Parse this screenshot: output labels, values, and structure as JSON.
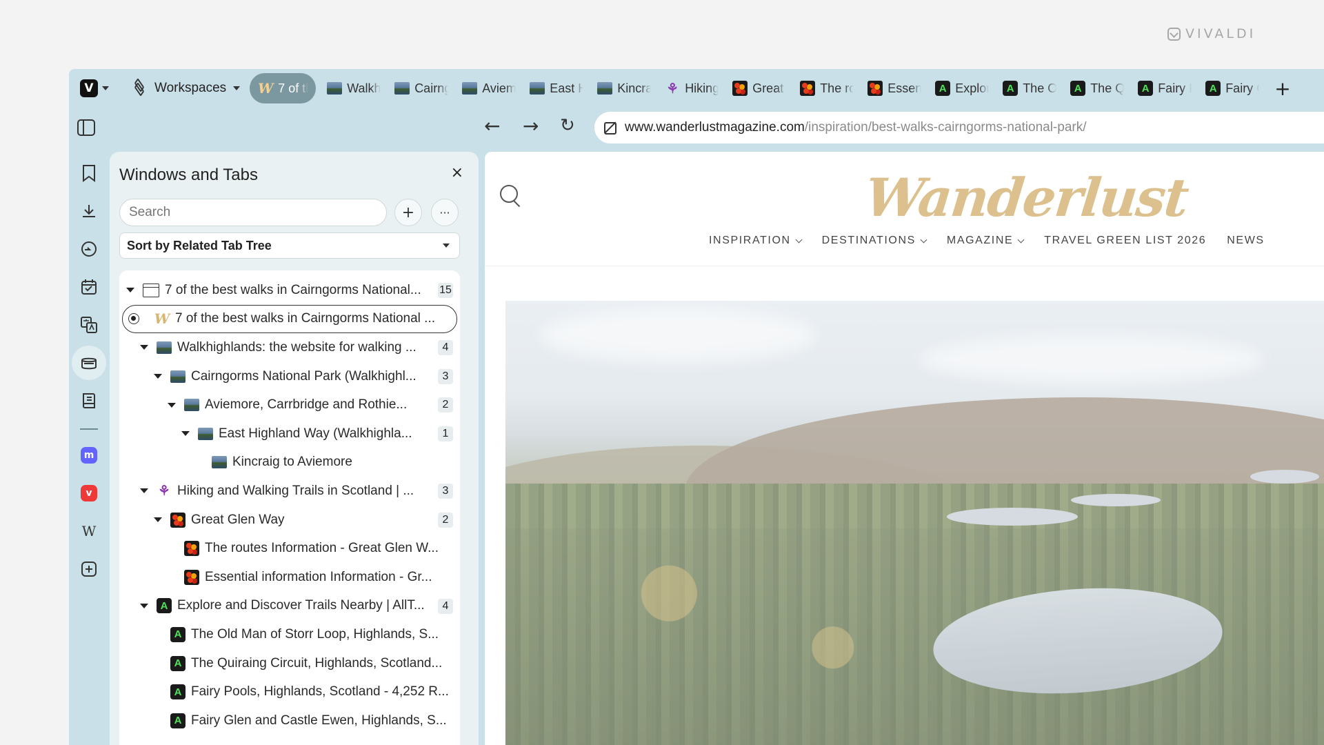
{
  "brand_watermark": "VIVALDI",
  "tabbar": {
    "workspaces_label": "Workspaces",
    "stack_tab": "7 of th",
    "tabs": [
      {
        "title": "Walkh",
        "favicon": "walkhighlands-icon"
      },
      {
        "title": "Cairng",
        "favicon": "walkhighlands-icon"
      },
      {
        "title": "Aviem",
        "favicon": "walkhighlands-icon"
      },
      {
        "title": "East H",
        "favicon": "walkhighlands-icon"
      },
      {
        "title": "Kincra",
        "favicon": "walkhighlands-icon"
      },
      {
        "title": "Hiking",
        "favicon": "thistle-icon"
      },
      {
        "title": "Great",
        "favicon": "great-glen-icon"
      },
      {
        "title": "The ro",
        "favicon": "great-glen-icon"
      },
      {
        "title": "Essent",
        "favicon": "great-glen-icon"
      },
      {
        "title": "Explor",
        "favicon": "alltrails-icon"
      },
      {
        "title": "The O",
        "favicon": "alltrails-icon"
      },
      {
        "title": "The Q",
        "favicon": "alltrails-icon"
      },
      {
        "title": "Fairy P",
        "favicon": "alltrails-icon"
      },
      {
        "title": "Fairy G",
        "favicon": "alltrails-icon"
      }
    ],
    "new_tab": "+"
  },
  "address": {
    "domain": "www.wanderlustmagazine.com",
    "path": "/inspiration/best-walks-cairngorms-national-park/"
  },
  "panel": {
    "title": "Windows and Tabs",
    "close": "×",
    "search_placeholder": "Search",
    "add": "+",
    "more": "···",
    "sort_label": "Sort by Related Tab Tree",
    "tree": [
      {
        "label": "7 of the best walks in Cairngorms National...",
        "count": "15",
        "kind": "window"
      },
      {
        "label": "7 of the best walks in Cairngorms National ...",
        "count": "",
        "kind": "current"
      },
      {
        "label": "Walkhighlands: the website for walking ...",
        "count": "4",
        "depth": 1,
        "favicon": "walkhighlands-icon"
      },
      {
        "label": "Cairngorms National Park (Walkhighl...",
        "count": "3",
        "depth": 2,
        "favicon": "walkhighlands-icon"
      },
      {
        "label": "Aviemore, Carrbridge and Rothie...",
        "count": "2",
        "depth": 3,
        "favicon": "walkhighlands-icon"
      },
      {
        "label": "East Highland Way (Walkhighla...",
        "count": "1",
        "depth": 4,
        "favicon": "walkhighlands-icon"
      },
      {
        "label": "Kincraig to Aviemore",
        "count": "",
        "depth": 5,
        "favicon": "walkhighlands-icon"
      },
      {
        "label": "Hiking and Walking Trails in Scotland | ...",
        "count": "3",
        "depth": 1,
        "favicon": "thistle-icon"
      },
      {
        "label": "Great Glen Way",
        "count": "2",
        "depth": 2,
        "favicon": "great-glen-icon"
      },
      {
        "label": "The routes Information - Great Glen W...",
        "count": "",
        "depth": 3,
        "favicon": "great-glen-icon"
      },
      {
        "label": "Essential information Information - Gr...",
        "count": "",
        "depth": 3,
        "favicon": "great-glen-icon"
      },
      {
        "label": "Explore and Discover Trails Nearby | AllT...",
        "count": "4",
        "depth": 1,
        "favicon": "alltrails-icon"
      },
      {
        "label": "The Old Man of Storr Loop, Highlands, S...",
        "count": "",
        "depth": 2,
        "favicon": "alltrails-icon"
      },
      {
        "label": "The Quiraing Circuit, Highlands, Scotland...",
        "count": "",
        "depth": 2,
        "favicon": "alltrails-icon"
      },
      {
        "label": "Fairy Pools, Highlands, Scotland - 4,252 R...",
        "count": "",
        "depth": 2,
        "favicon": "alltrails-icon"
      },
      {
        "label": "Fairy Glen and Castle Ewen, Highlands, S...",
        "count": "",
        "depth": 2,
        "favicon": "alltrails-icon"
      }
    ]
  },
  "website": {
    "logo": "Wanderlust",
    "nav": [
      "INSPIRATION",
      "DESTINATIONS",
      "MAGAZINE",
      "TRAVEL GREEN LIST 2026",
      "NEWS"
    ]
  }
}
